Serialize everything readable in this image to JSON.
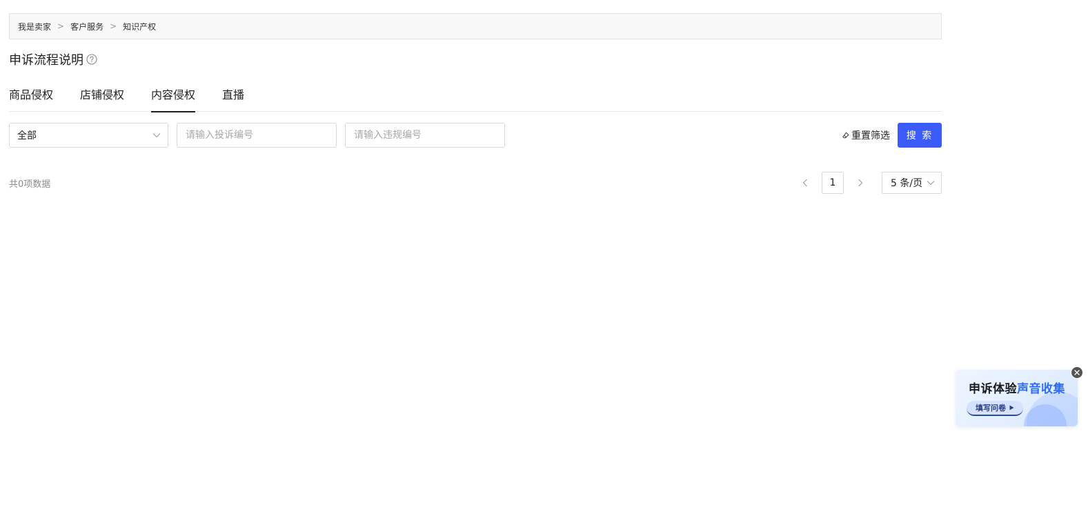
{
  "breadcrumb": {
    "items": [
      "我是卖家",
      "客户服务",
      "知识产权"
    ],
    "separator": ">"
  },
  "header": {
    "title": "申诉流程说明",
    "help_icon": "question-circle-icon"
  },
  "tabs": [
    {
      "label": "商品侵权",
      "active": false
    },
    {
      "label": "店铺侵权",
      "active": false
    },
    {
      "label": "内容侵权",
      "active": true
    },
    {
      "label": "直播",
      "active": false
    }
  ],
  "filters": {
    "status_select": {
      "value": "全部"
    },
    "complaint_input": {
      "value": "",
      "placeholder": "请输入投诉编号"
    },
    "violation_input": {
      "value": "",
      "placeholder": "请输入违规编号"
    },
    "reset_label": "重置筛选",
    "search_label": "搜 索"
  },
  "results": {
    "total_text": "共0项数据"
  },
  "pagination": {
    "current_page": "1",
    "page_size_label": "5 条/页"
  },
  "survey_card": {
    "title_part1": "申诉体验",
    "title_part2": "声音收集",
    "button_label": "填写问卷"
  },
  "colors": {
    "primary": "#3b5bfa",
    "accent_blue": "#2f6cf6",
    "text": "#1f1f1f",
    "muted": "#8c8c8c",
    "border": "#d9d9d9"
  }
}
